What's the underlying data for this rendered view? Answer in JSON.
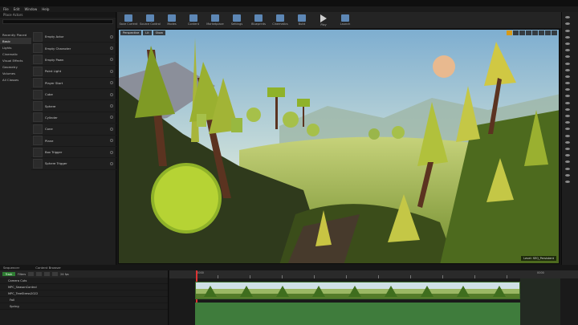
{
  "menu": [
    "File",
    "Edit",
    "Window",
    "Help"
  ],
  "place_actors": {
    "title": "Place Actors",
    "categories": [
      "Recently Placed",
      "Basic",
      "Lights",
      "Cinematic",
      "Visual Effects",
      "Geometry",
      "Volumes",
      "All Classes"
    ],
    "active_category": "Basic",
    "items": [
      "Empty Actor",
      "Empty Character",
      "Empty Pawn",
      "Point Light",
      "Player Start",
      "Cube",
      "Sphere",
      "Cylinder",
      "Cone",
      "Plane",
      "Box Trigger",
      "Sphere Trigger"
    ]
  },
  "toolbar": [
    "Save Current",
    "Source Control",
    "Modes",
    "Content",
    "Marketplace",
    "Settings",
    "Blueprints",
    "Cinematics",
    "Build",
    "Play",
    "Launch"
  ],
  "viewport": {
    "buttons": [
      "Perspective",
      "Lit",
      "Show"
    ],
    "level_label": "Level: SEQ_Persistent"
  },
  "sequencer": {
    "tabs": [
      "Sequencer",
      "Content Browser"
    ],
    "track_button": "Track",
    "filters": "Filters",
    "fps": "24 fps",
    "tracks": [
      "Camera Cuts",
      "MPC_SeasonControl",
      "MPC_TreeStress2022",
      "Fall",
      "Spring"
    ],
    "ruler_labels": [
      "0000",
      "0000"
    ]
  },
  "colors": {
    "accent": "#d69a1a",
    "playhead": "#d33333",
    "track_green": "#3f7c3c"
  }
}
